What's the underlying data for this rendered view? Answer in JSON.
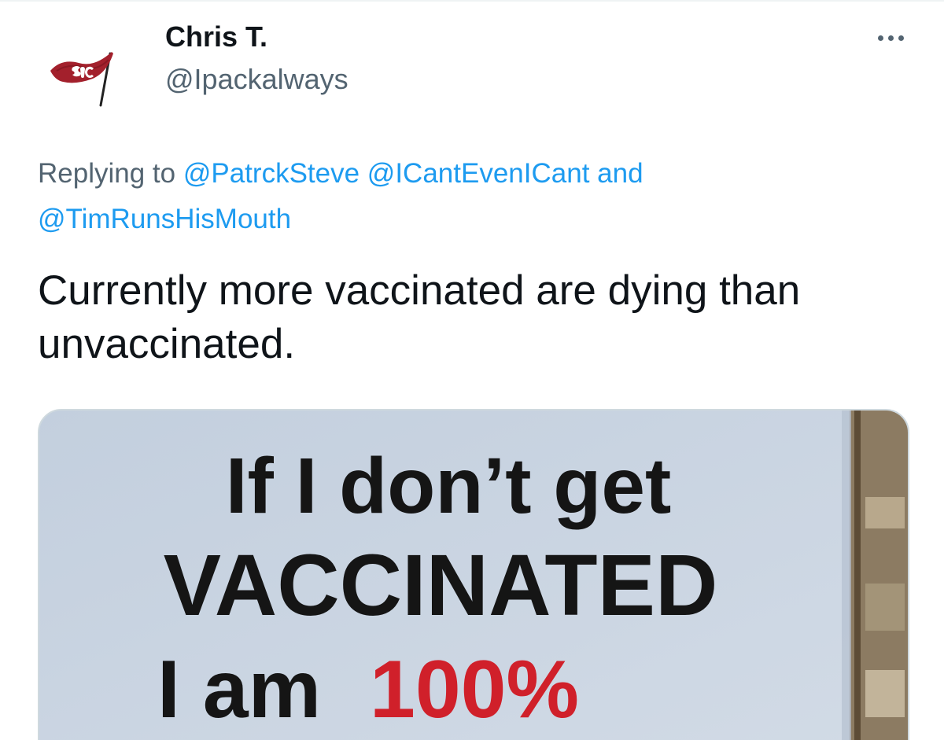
{
  "author": {
    "display_name": "Chris T.",
    "handle": "@Ipackalways",
    "avatar_icon": "flag-icon"
  },
  "header": {
    "more_icon": "more-horizontal-icon"
  },
  "reply": {
    "prefix": "Replying to",
    "mentions": [
      "@PatrckSteve",
      "@ICantEvenICant",
      "@TimRunsHisMouth"
    ],
    "joiner": "and"
  },
  "tweet": {
    "text": "Currently more vaccinated are dying than unvaccinated."
  },
  "media": {
    "sign_lines": [
      "If I don’t get",
      "VACCINATED",
      "I am",
      "100%"
    ],
    "colors": {
      "sign_background": "#c9d4e2",
      "sign_text": "#111111",
      "sign_highlight": "#d0202a"
    }
  },
  "colors": {
    "link": "#1d9bf0",
    "secondary_text": "#536471",
    "primary_text": "#0f1419",
    "flag": "#a3202c"
  }
}
